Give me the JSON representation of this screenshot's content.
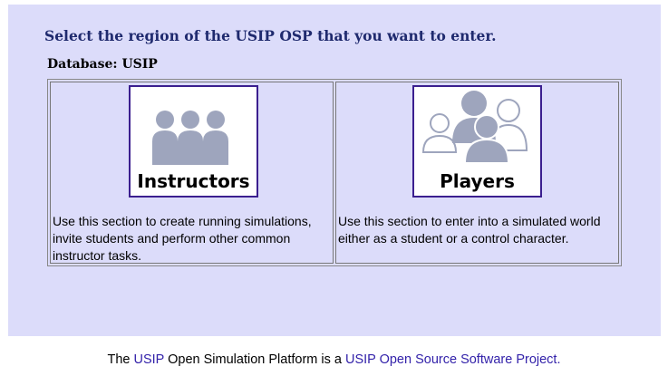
{
  "heading": "Select the region of the USIP OSP that you want to enter.",
  "database_label": "Database: USIP",
  "sections": {
    "instructors": {
      "label": "Instructors",
      "icon": "instructors-group-icon",
      "description": "Use this section to create running simulations, invite students and perform other common instructor tasks."
    },
    "players": {
      "label": "Players",
      "icon": "players-group-icon",
      "description": "Use this section to enter into a simulated world either as a student or a control character."
    }
  },
  "footer": {
    "text_1": "The ",
    "link_1": "USIP",
    "text_2": " Open Simulation Platform is a ",
    "link_2": "USIP Open Source Software Project."
  },
  "colors": {
    "panel_bg": "#dcdcfa",
    "heading": "#1f2a6e",
    "tile_border": "#3b1f8f",
    "link": "#3322aa",
    "icon_gray": "#9ea5bd"
  }
}
